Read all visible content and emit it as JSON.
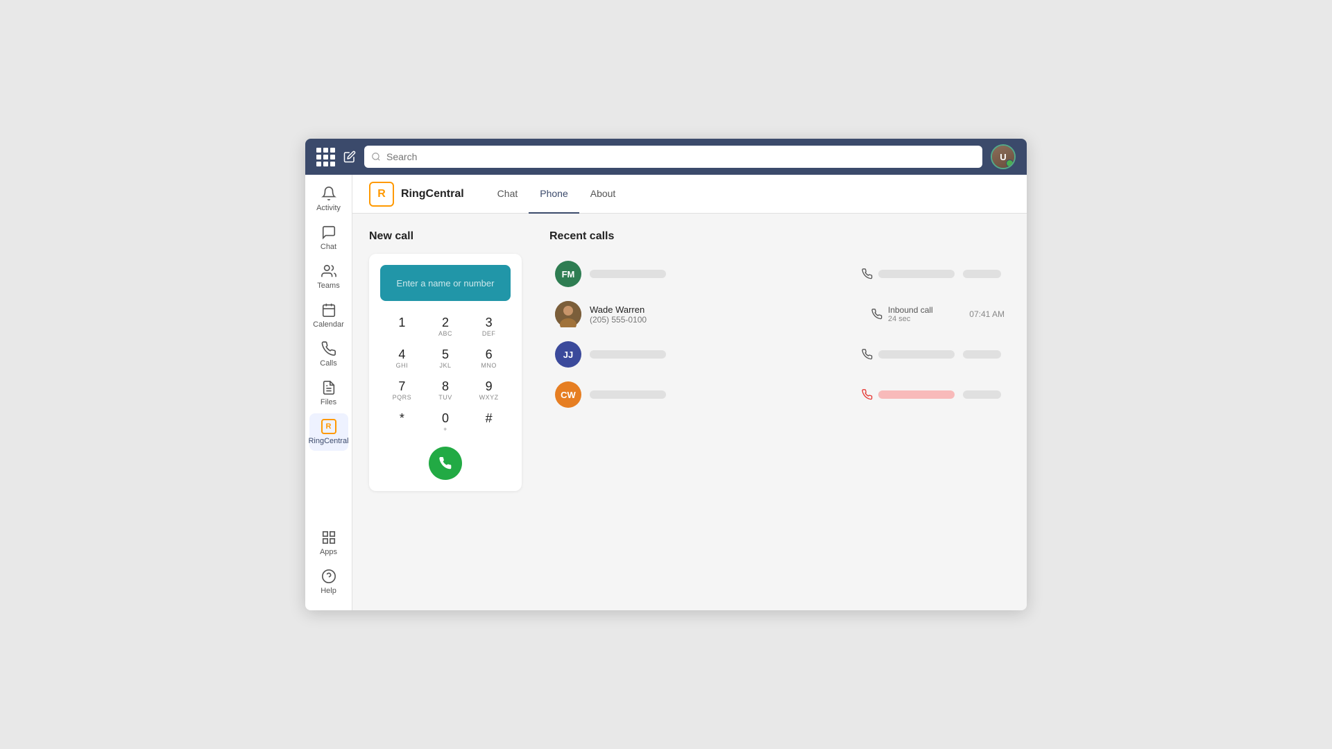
{
  "topbar": {
    "search_placeholder": "Search"
  },
  "sidebar": {
    "items": [
      {
        "id": "activity",
        "label": "Activity",
        "active": false
      },
      {
        "id": "chat",
        "label": "Chat",
        "active": false
      },
      {
        "id": "teams",
        "label": "Teams",
        "active": false
      },
      {
        "id": "calendar",
        "label": "Calendar",
        "active": false
      },
      {
        "id": "calls",
        "label": "Calls",
        "active": false
      },
      {
        "id": "files",
        "label": "Files",
        "active": false
      },
      {
        "id": "ringcentral",
        "label": "RingCentral",
        "active": true
      }
    ],
    "bottom_items": [
      {
        "id": "apps",
        "label": "Apps"
      },
      {
        "id": "help",
        "label": "Help"
      }
    ]
  },
  "app_header": {
    "logo_letter": "R",
    "app_name": "RingCentral",
    "tabs": [
      {
        "id": "chat",
        "label": "Chat",
        "active": false
      },
      {
        "id": "phone",
        "label": "Phone",
        "active": true
      },
      {
        "id": "about",
        "label": "About",
        "active": false
      }
    ]
  },
  "dialpad": {
    "section_title": "New call",
    "input_placeholder": "Enter a name or number",
    "keys": [
      {
        "num": "1",
        "letters": ""
      },
      {
        "num": "2",
        "letters": "ABC"
      },
      {
        "num": "3",
        "letters": "DEF"
      },
      {
        "num": "4",
        "letters": "GHI"
      },
      {
        "num": "5",
        "letters": "JKL"
      },
      {
        "num": "6",
        "letters": "MNO"
      },
      {
        "num": "7",
        "letters": "PQRS"
      },
      {
        "num": "8",
        "letters": "TUV"
      },
      {
        "num": "9",
        "letters": "WXYZ"
      },
      {
        "num": "*",
        "letters": ""
      },
      {
        "num": "0",
        "letters": "+"
      },
      {
        "num": "#",
        "letters": ""
      }
    ]
  },
  "recent_calls": {
    "section_title": "Recent calls",
    "calls": [
      {
        "id": 1,
        "initials": "FM",
        "bg_color": "#2e7d52",
        "name_skeleton": true,
        "name": null,
        "number": null,
        "call_type": "outbound",
        "duration": null,
        "time": null,
        "missed": false
      },
      {
        "id": 2,
        "initials": null,
        "bg_color": "#7b5e3a",
        "avatar_type": "photo",
        "name": "Wade Warren",
        "number": "(205) 555-0100",
        "call_type_label": "Inbound call",
        "duration": "24 sec",
        "time": "07:41 AM",
        "missed": false
      },
      {
        "id": 3,
        "initials": "JJ",
        "bg_color": "#3b4a9b",
        "name_skeleton": true,
        "name": null,
        "number": null,
        "call_type": "outbound",
        "duration": null,
        "time": null,
        "missed": false
      },
      {
        "id": 4,
        "initials": "CW",
        "bg_color": "#e67e22",
        "name_skeleton": true,
        "name": null,
        "number": null,
        "call_type": "missed",
        "duration": null,
        "time": null,
        "missed": true
      }
    ]
  },
  "colors": {
    "topbar": "#3b4a6b",
    "active_tab_underline": "#3b4a6b",
    "call_btn": "#22aa44",
    "dialpad_input": "#2196a8"
  }
}
